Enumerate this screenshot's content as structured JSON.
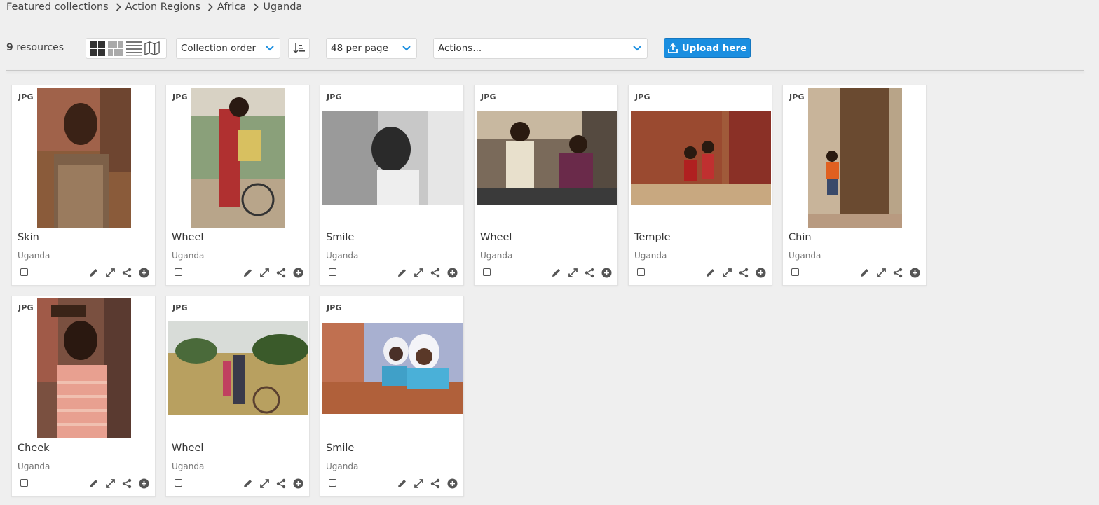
{
  "breadcrumb": [
    "Featured collections",
    "Action Regions",
    "Africa",
    "Uganda"
  ],
  "toolbar": {
    "count": "9",
    "count_label": " resources",
    "sort_label": "Collection order",
    "perpage_label": "48 per page",
    "actions_label": "Actions...",
    "upload_label": "Upload here"
  },
  "colors": {
    "accent": "#1a8ee0",
    "background": "#efefef"
  },
  "cards": [
    {
      "type": "JPG",
      "title": "Skin",
      "region": "Uganda"
    },
    {
      "type": "JPG",
      "title": "Wheel",
      "region": "Uganda"
    },
    {
      "type": "JPG",
      "title": "Smile",
      "region": "Uganda"
    },
    {
      "type": "JPG",
      "title": "Wheel",
      "region": "Uganda"
    },
    {
      "type": "JPG",
      "title": "Temple",
      "region": "Uganda"
    },
    {
      "type": "JPG",
      "title": "Chin",
      "region": "Uganda"
    },
    {
      "type": "JPG",
      "title": "Cheek",
      "region": "Uganda"
    },
    {
      "type": "JPG",
      "title": "Wheel",
      "region": "Uganda"
    },
    {
      "type": "JPG",
      "title": "Smile",
      "region": "Uganda"
    }
  ],
  "card_tools": [
    "edit-icon",
    "fullscreen-icon",
    "share-icon",
    "add-icon"
  ]
}
